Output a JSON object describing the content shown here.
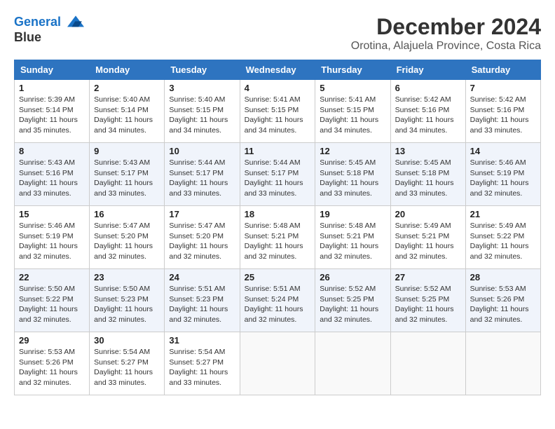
{
  "header": {
    "logo_line1": "General",
    "logo_line2": "Blue",
    "month_title": "December 2024",
    "location": "Orotina, Alajuela Province, Costa Rica"
  },
  "weekdays": [
    "Sunday",
    "Monday",
    "Tuesday",
    "Wednesday",
    "Thursday",
    "Friday",
    "Saturday"
  ],
  "weeks": [
    [
      {
        "day": "1",
        "sunrise": "5:39 AM",
        "sunset": "5:14 PM",
        "daylight": "11 hours and 35 minutes."
      },
      {
        "day": "2",
        "sunrise": "5:40 AM",
        "sunset": "5:14 PM",
        "daylight": "11 hours and 34 minutes."
      },
      {
        "day": "3",
        "sunrise": "5:40 AM",
        "sunset": "5:15 PM",
        "daylight": "11 hours and 34 minutes."
      },
      {
        "day": "4",
        "sunrise": "5:41 AM",
        "sunset": "5:15 PM",
        "daylight": "11 hours and 34 minutes."
      },
      {
        "day": "5",
        "sunrise": "5:41 AM",
        "sunset": "5:15 PM",
        "daylight": "11 hours and 34 minutes."
      },
      {
        "day": "6",
        "sunrise": "5:42 AM",
        "sunset": "5:16 PM",
        "daylight": "11 hours and 34 minutes."
      },
      {
        "day": "7",
        "sunrise": "5:42 AM",
        "sunset": "5:16 PM",
        "daylight": "11 hours and 33 minutes."
      }
    ],
    [
      {
        "day": "8",
        "sunrise": "5:43 AM",
        "sunset": "5:16 PM",
        "daylight": "11 hours and 33 minutes."
      },
      {
        "day": "9",
        "sunrise": "5:43 AM",
        "sunset": "5:17 PM",
        "daylight": "11 hours and 33 minutes."
      },
      {
        "day": "10",
        "sunrise": "5:44 AM",
        "sunset": "5:17 PM",
        "daylight": "11 hours and 33 minutes."
      },
      {
        "day": "11",
        "sunrise": "5:44 AM",
        "sunset": "5:17 PM",
        "daylight": "11 hours and 33 minutes."
      },
      {
        "day": "12",
        "sunrise": "5:45 AM",
        "sunset": "5:18 PM",
        "daylight": "11 hours and 33 minutes."
      },
      {
        "day": "13",
        "sunrise": "5:45 AM",
        "sunset": "5:18 PM",
        "daylight": "11 hours and 33 minutes."
      },
      {
        "day": "14",
        "sunrise": "5:46 AM",
        "sunset": "5:19 PM",
        "daylight": "11 hours and 32 minutes."
      }
    ],
    [
      {
        "day": "15",
        "sunrise": "5:46 AM",
        "sunset": "5:19 PM",
        "daylight": "11 hours and 32 minutes."
      },
      {
        "day": "16",
        "sunrise": "5:47 AM",
        "sunset": "5:20 PM",
        "daylight": "11 hours and 32 minutes."
      },
      {
        "day": "17",
        "sunrise": "5:47 AM",
        "sunset": "5:20 PM",
        "daylight": "11 hours and 32 minutes."
      },
      {
        "day": "18",
        "sunrise": "5:48 AM",
        "sunset": "5:21 PM",
        "daylight": "11 hours and 32 minutes."
      },
      {
        "day": "19",
        "sunrise": "5:48 AM",
        "sunset": "5:21 PM",
        "daylight": "11 hours and 32 minutes."
      },
      {
        "day": "20",
        "sunrise": "5:49 AM",
        "sunset": "5:21 PM",
        "daylight": "11 hours and 32 minutes."
      },
      {
        "day": "21",
        "sunrise": "5:49 AM",
        "sunset": "5:22 PM",
        "daylight": "11 hours and 32 minutes."
      }
    ],
    [
      {
        "day": "22",
        "sunrise": "5:50 AM",
        "sunset": "5:22 PM",
        "daylight": "11 hours and 32 minutes."
      },
      {
        "day": "23",
        "sunrise": "5:50 AM",
        "sunset": "5:23 PM",
        "daylight": "11 hours and 32 minutes."
      },
      {
        "day": "24",
        "sunrise": "5:51 AM",
        "sunset": "5:23 PM",
        "daylight": "11 hours and 32 minutes."
      },
      {
        "day": "25",
        "sunrise": "5:51 AM",
        "sunset": "5:24 PM",
        "daylight": "11 hours and 32 minutes."
      },
      {
        "day": "26",
        "sunrise": "5:52 AM",
        "sunset": "5:25 PM",
        "daylight": "11 hours and 32 minutes."
      },
      {
        "day": "27",
        "sunrise": "5:52 AM",
        "sunset": "5:25 PM",
        "daylight": "11 hours and 32 minutes."
      },
      {
        "day": "28",
        "sunrise": "5:53 AM",
        "sunset": "5:26 PM",
        "daylight": "11 hours and 32 minutes."
      }
    ],
    [
      {
        "day": "29",
        "sunrise": "5:53 AM",
        "sunset": "5:26 PM",
        "daylight": "11 hours and 32 minutes."
      },
      {
        "day": "30",
        "sunrise": "5:54 AM",
        "sunset": "5:27 PM",
        "daylight": "11 hours and 33 minutes."
      },
      {
        "day": "31",
        "sunrise": "5:54 AM",
        "sunset": "5:27 PM",
        "daylight": "11 hours and 33 minutes."
      },
      null,
      null,
      null,
      null
    ]
  ]
}
